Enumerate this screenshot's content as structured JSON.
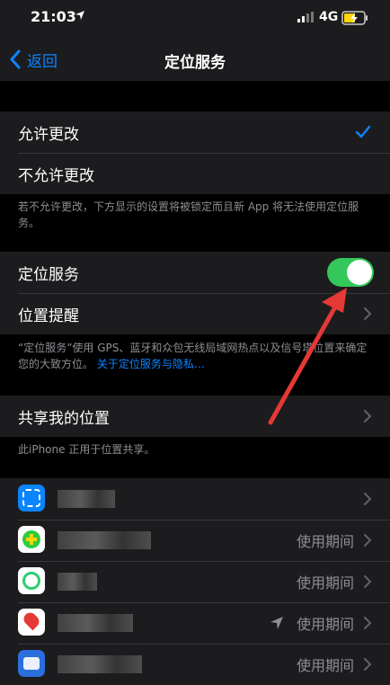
{
  "status": {
    "time": "21:03",
    "network": "4G"
  },
  "nav": {
    "back_label": "返回",
    "title": "定位服务"
  },
  "permission": {
    "allow": "允许更改",
    "disallow": "不允许更改",
    "note": "若不允许更改，下方显示的设置将被锁定而且新 App 将无法使用定位服务。"
  },
  "location": {
    "service_label": "定位服务",
    "service_on": true,
    "alerts_label": "位置提醒",
    "note_text": "“定位服务”使用 GPS、蓝牙和众包无线局域网热点以及信号塔位置来确定您的大致方位。",
    "note_link": "关于定位服务与隐私…"
  },
  "share": {
    "label": "共享我的位置",
    "note": "此iPhone 正用于位置共享。"
  },
  "apps": [
    {
      "value": "",
      "icon": "blue-square-app-icon"
    },
    {
      "value": "使用期间",
      "icon": "green-plus-app-icon"
    },
    {
      "value": "使用期间",
      "icon": "green-sync-app-icon"
    },
    {
      "value": "使用期间",
      "icon": "red-du-app-icon",
      "recent_location": true
    },
    {
      "value": "使用期间",
      "icon": "blue-du-app-icon"
    }
  ],
  "colors": {
    "accent": "#0a84ff",
    "toggle_on": "#34c759",
    "annotation": "#e53935"
  }
}
